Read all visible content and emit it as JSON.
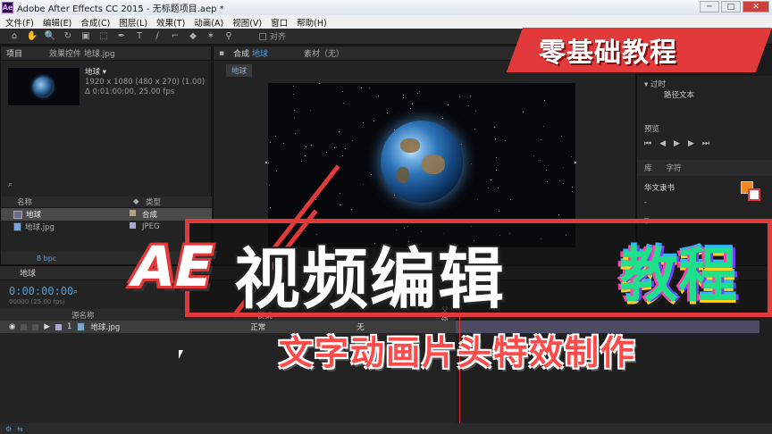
{
  "window": {
    "title": "Adobe After Effects CC 2015 - 无标题项目.aep *",
    "min": "─",
    "max": "□",
    "close": "✕"
  },
  "menu": [
    "文件(F)",
    "编辑(E)",
    "合成(C)",
    "图层(L)",
    "效果(T)",
    "动画(A)",
    "视图(V)",
    "窗口",
    "帮助(H)"
  ],
  "toolbar": {
    "tools": [
      "⌂",
      "✋",
      "🔍",
      "↻",
      "▣",
      "⬚",
      "✒",
      "T",
      "∕",
      "⌐",
      "◆",
      "✶",
      "⚲"
    ],
    "snap_label": "对齐"
  },
  "project": {
    "tab_label": "项目",
    "effects_tab": "效果控件 地球.jpg",
    "selected_name": "地球 ▾",
    "info_line1": "1920 x 1080 (480 x 270) (1.00)",
    "info_line2": "Δ 0:01:00:00, 25.00 fps",
    "search_icon": "⌕",
    "columns": {
      "name": "名称",
      "type": "类型"
    },
    "items": [
      {
        "name": "地球",
        "type": "合成",
        "label_color": "#b9a17a"
      },
      {
        "name": "地球.jpg",
        "type": "JPEG",
        "label_color": "#a7a7d8"
      }
    ],
    "bpc": "8 bpc"
  },
  "composition": {
    "tab_label": "合成",
    "comp_name": "地球",
    "footage_tab": "素材（无）",
    "viewer_label": "地球"
  },
  "right_panel": {
    "section_title": "▾ 过时",
    "path_text": "路径文本",
    "preview_label": "预览",
    "library_tab": "库",
    "character_tab": "字符",
    "font_name": "华文隶书",
    "font_style": "-",
    "size_label": "T"
  },
  "timeline": {
    "tab_label": "地球",
    "timecode": "0:00:00:00",
    "fps": "00000 (25.00 fps)",
    "columns": {
      "source": "源名称",
      "mode": "模式",
      "parent": "父级"
    },
    "layer": {
      "index": "1",
      "name": "地球.jpg",
      "mode": "正常",
      "parent": "无"
    }
  },
  "overlay": {
    "top_banner": "零基础教程",
    "ae": "AE",
    "main_title": "视频编辑",
    "jiaocheng": "教程",
    "subtitle": "文字动画片头特效制作"
  },
  "colors": {
    "accent_red": "#e23a3a",
    "timecode_blue": "#4a9fe0"
  }
}
